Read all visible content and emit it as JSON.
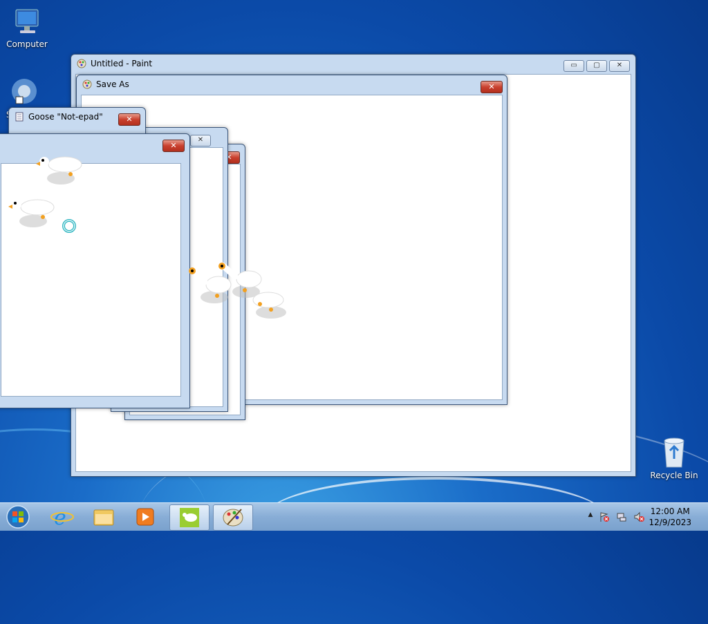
{
  "desktop": {
    "icons": [
      {
        "label": "Computer"
      },
      {
        "label": "S"
      },
      {
        "label": "Recycle Bin"
      }
    ]
  },
  "windows": {
    "paint": {
      "title": "Untitled - Paint",
      "min": "▭",
      "max": "▢",
      "close": "✕"
    },
    "save_as": {
      "title": "Save As",
      "close": "✕"
    },
    "goose_notepad": {
      "title": "Goose \"Not-epad\"",
      "close": "✕"
    },
    "goose_window_a": {
      "close": "✕"
    },
    "goose_window_b": {
      "close": "✕"
    },
    "goose_window_c": {
      "close": "✕"
    }
  },
  "taskbar": {
    "start": "start-orb",
    "pinned": [
      "internet-explorer-icon",
      "windows-explorer-icon",
      "media-player-icon",
      "desktop-goose-icon",
      "paint-icon"
    ],
    "tray": {
      "show_hidden": "▲"
    },
    "clock": {
      "time": "12:00 AM",
      "date": "12/9/2023"
    }
  },
  "colors": {
    "titlebar": "#c7daf0",
    "close_button": "#c9402e",
    "taskbar": "#88add6",
    "desktop": "#0b4aa8"
  }
}
